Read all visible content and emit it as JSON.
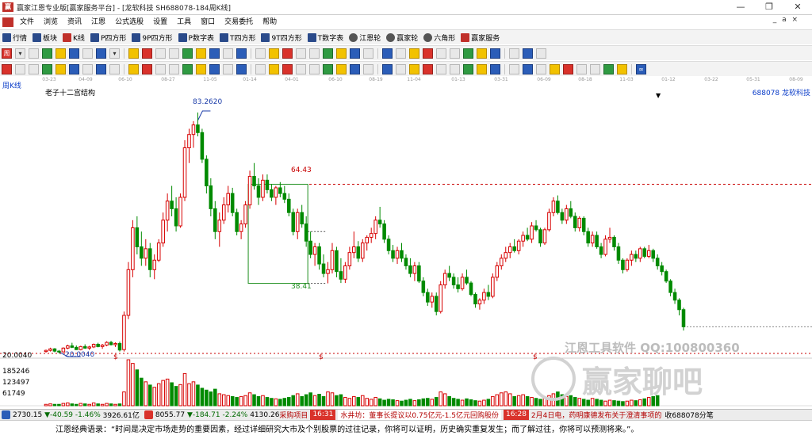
{
  "window": {
    "title": "赢家江恩专业版[赢家服务平台] - [龙软科技  SH688078-184周K线]",
    "controls": [
      "—",
      "❐",
      "✕"
    ]
  },
  "menu": {
    "items": [
      "文件",
      "浏览",
      "资讯",
      "江恩",
      "公式选股",
      "设置",
      "工具",
      "窗口",
      "交易委托",
      "帮助"
    ],
    "sub_controls": "_ a ×"
  },
  "toolbar1": {
    "items": [
      "行情",
      "板块",
      "K线",
      "P四方形",
      "9P四方形",
      "P数字表",
      "T四方形",
      "9T四方形",
      "T数字表",
      "江恩轮",
      "赢家轮",
      "六角形",
      "赢家服务"
    ]
  },
  "toolbar2": {
    "icons": [
      "周",
      "▾",
      "",
      "",
      "",
      "",
      "",
      "",
      "▾",
      "",
      "",
      "",
      "",
      "",
      "",
      "",
      "",
      "",
      "",
      "",
      "",
      "",
      "",
      "",
      "",
      "",
      "",
      "",
      "",
      "",
      "",
      "",
      "",
      "",
      "",
      "",
      "",
      "",
      ""
    ]
  },
  "toolbar3": {
    "icons": [
      "",
      "",
      "",
      "",
      "",
      "",
      "",
      "",
      "",
      "",
      "",
      "",
      "",
      "",
      "",
      "",
      "",
      "",
      "",
      "",
      "",
      "",
      "",
      "",
      "",
      "",
      "",
      "",
      "",
      "",
      "",
      "",
      "",
      "",
      "",
      "",
      "",
      "",
      "",
      "",
      "",
      "",
      "",
      "",
      "",
      "∞"
    ]
  },
  "chart": {
    "period_label": "周K线",
    "title": "老子十二宫结构",
    "stock": "688078  龙软科技",
    "date_ticks": [
      "03-23",
      "04-09",
      "06-10",
      "08-27",
      "11-05",
      "01-14",
      "04-01",
      "06-10",
      "08-19",
      "11-04",
      "01-13",
      "03-31",
      "06-09",
      "08-18",
      "11-03",
      "01-12",
      "03-22",
      "05-31",
      "08-09"
    ],
    "annotations": {
      "high": "83.2620",
      "box_top": "64.43",
      "box_bottom": "38.41",
      "low": "20.0040",
      "axis_low": "20.0040"
    },
    "volume_ticks": [
      "185246",
      "123497",
      "61749"
    ],
    "dollar_marks": [
      "$",
      "$",
      "$"
    ],
    "watermark_text": "江恩工具软件  QQ:100800360",
    "watermark_brand": "赢家聊吧",
    "colors": {
      "up": "#d70000",
      "down": "#008a00",
      "annot": "#1a3ba8",
      "box": "#1f8f1f",
      "dashed": "#c80000"
    },
    "candles": [
      [
        20.5,
        21.0,
        20.2,
        20.8
      ],
      [
        20.8,
        21.5,
        20.5,
        21.2
      ],
      [
        21.2,
        21.4,
        20.3,
        20.6
      ],
      [
        20.6,
        20.9,
        20.0,
        20.4
      ],
      [
        20.4,
        21.6,
        20.3,
        21.4
      ],
      [
        21.4,
        22.3,
        21.1,
        22.0
      ],
      [
        22.0,
        22.8,
        21.4,
        21.6
      ],
      [
        21.6,
        22.1,
        20.9,
        21.0
      ],
      [
        21.0,
        22.0,
        20.8,
        21.8
      ],
      [
        21.8,
        22.4,
        21.2,
        21.4
      ],
      [
        21.4,
        22.0,
        20.9,
        21.7
      ],
      [
        21.7,
        22.6,
        21.4,
        22.4
      ],
      [
        22.4,
        22.8,
        21.6,
        21.8
      ],
      [
        21.8,
        22.5,
        21.2,
        22.2
      ],
      [
        22.2,
        23.2,
        21.9,
        22.9
      ],
      [
        22.9,
        23.3,
        22.1,
        22.3
      ],
      [
        22.3,
        22.9,
        21.7,
        22.6
      ],
      [
        22.6,
        23.1,
        20.5,
        20.9
      ],
      [
        21.0,
        31.0,
        20.5,
        30.0
      ],
      [
        30.0,
        44.0,
        29.0,
        42.0
      ],
      [
        42.0,
        55.0,
        40.0,
        53.0
      ],
      [
        53.0,
        56.0,
        46.0,
        48.0
      ],
      [
        48.0,
        52.0,
        43.0,
        45.0
      ],
      [
        45.0,
        50.0,
        43.0,
        47.5
      ],
      [
        47.5,
        49.0,
        40.0,
        42.0
      ],
      [
        42.0,
        46.0,
        39.5,
        44.5
      ],
      [
        44.5,
        50.0,
        44.0,
        49.0
      ],
      [
        49.0,
        57.0,
        48.0,
        55.0
      ],
      [
        55.0,
        62.0,
        52.0,
        60.0
      ],
      [
        60.0,
        64.0,
        56.0,
        58.0
      ],
      [
        58.0,
        61.0,
        52.0,
        53.5
      ],
      [
        53.5,
        62.0,
        53.0,
        61.0
      ],
      [
        61.0,
        76.0,
        60.0,
        74.0
      ],
      [
        74.0,
        79.0,
        70.0,
        77.5
      ],
      [
        77.5,
        81.0,
        74.0,
        80.0
      ],
      [
        80.0,
        83.26,
        77.0,
        78.0
      ],
      [
        78.0,
        79.0,
        70.0,
        71.0
      ],
      [
        71.0,
        72.0,
        62.0,
        64.0
      ],
      [
        64.0,
        66.0,
        56.0,
        58.0
      ],
      [
        58.0,
        60.0,
        50.0,
        52.0
      ],
      [
        52.0,
        57.0,
        48.0,
        55.0
      ],
      [
        55.0,
        61.0,
        54.0,
        59.0
      ],
      [
        59.0,
        64.0,
        57.0,
        62.0
      ],
      [
        62.0,
        63.5,
        56.0,
        57.0
      ],
      [
        57.0,
        58.0,
        51.0,
        52.0
      ],
      [
        52.0,
        55.0,
        50.0,
        54.0
      ],
      [
        54.0,
        60.0,
        53.0,
        59.0
      ],
      [
        59.0,
        68.0,
        58.0,
        66.5
      ],
      [
        66.5,
        70.0,
        63.0,
        64.0
      ],
      [
        64.0,
        66.0,
        59.0,
        61.0
      ],
      [
        61.0,
        67.0,
        60.0,
        65.5
      ],
      [
        65.5,
        67.0,
        62.0,
        63.0
      ],
      [
        63.0,
        64.5,
        60.0,
        61.0
      ],
      [
        61.0,
        64.0,
        59.0,
        63.5
      ],
      [
        63.5,
        65.0,
        61.0,
        62.0
      ],
      [
        62.0,
        64.0,
        59.5,
        60.5
      ],
      [
        60.5,
        62.0,
        56.0,
        57.0
      ],
      [
        57.0,
        58.0,
        51.0,
        52.0
      ],
      [
        52.0,
        58.0,
        50.0,
        57.0
      ],
      [
        57.0,
        59.0,
        53.0,
        54.0
      ],
      [
        54.0,
        56.0,
        48.0,
        49.5
      ],
      [
        49.5,
        52.0,
        45.0,
        46.0
      ],
      [
        46.0,
        49.0,
        43.0,
        48.0
      ],
      [
        48.0,
        49.0,
        42.0,
        43.5
      ],
      [
        43.5,
        46.0,
        40.0,
        41.0
      ],
      [
        41.0,
        44.0,
        38.41,
        42.0
      ],
      [
        42.0,
        49.0,
        41.0,
        47.0
      ],
      [
        47.0,
        48.0,
        40.0,
        41.5
      ],
      [
        41.5,
        45.0,
        38.5,
        39.5
      ],
      [
        39.5,
        44.0,
        38.5,
        43.0
      ],
      [
        43.0,
        48.0,
        42.0,
        46.5
      ],
      [
        46.5,
        52.0,
        45.0,
        48.0
      ],
      [
        48.0,
        49.5,
        44.0,
        45.0
      ],
      [
        45.0,
        50.0,
        44.0,
        49.0
      ],
      [
        49.0,
        51.0,
        47.0,
        50.5
      ],
      [
        50.5,
        53.0,
        49.0,
        51.5
      ],
      [
        51.5,
        56.0,
        50.0,
        55.0
      ],
      [
        55.0,
        58.5,
        53.0,
        54.0
      ],
      [
        54.0,
        55.0,
        49.0,
        50.0
      ],
      [
        50.0,
        51.0,
        46.0,
        47.0
      ],
      [
        47.0,
        48.5,
        44.0,
        45.0
      ],
      [
        45.0,
        48.0,
        43.5,
        47.0
      ],
      [
        47.0,
        49.0,
        44.0,
        45.0
      ],
      [
        45.0,
        46.0,
        42.0,
        43.0
      ],
      [
        43.0,
        45.0,
        40.0,
        41.0
      ],
      [
        41.0,
        44.0,
        39.0,
        43.0
      ],
      [
        43.0,
        44.0,
        38.5,
        39.0
      ],
      [
        39.0,
        40.0,
        35.0,
        36.0
      ],
      [
        36.0,
        37.0,
        32.5,
        33.5
      ],
      [
        33.5,
        36.0,
        32.0,
        35.0
      ],
      [
        35.0,
        36.0,
        30.0,
        31.0
      ],
      [
        31.0,
        39.0,
        30.5,
        38.0
      ],
      [
        38.0,
        42.0,
        37.0,
        41.0
      ],
      [
        41.0,
        43.0,
        39.0,
        40.0
      ],
      [
        40.0,
        41.0,
        37.0,
        38.0
      ],
      [
        38.0,
        40.0,
        36.0,
        37.0
      ],
      [
        37.0,
        41.0,
        36.5,
        40.0
      ],
      [
        40.0,
        42.0,
        38.0,
        38.5
      ],
      [
        38.5,
        39.0,
        35.0,
        35.5
      ],
      [
        35.5,
        36.0,
        32.0,
        33.0
      ],
      [
        33.0,
        34.5,
        31.5,
        34.0
      ],
      [
        34.0,
        37.0,
        33.0,
        36.0
      ],
      [
        36.0,
        38.0,
        34.0,
        35.0
      ],
      [
        35.0,
        41.0,
        34.5,
        40.0
      ],
      [
        40.0,
        44.0,
        39.0,
        43.0
      ],
      [
        43.0,
        46.0,
        42.0,
        45.0
      ],
      [
        45.0,
        48.0,
        44.0,
        46.5
      ],
      [
        46.5,
        49.0,
        45.0,
        48.0
      ],
      [
        48.0,
        50.0,
        46.5,
        47.0
      ],
      [
        47.0,
        50.0,
        46.0,
        49.5
      ],
      [
        49.5,
        52.0,
        48.0,
        51.0
      ],
      [
        51.0,
        53.0,
        49.5,
        50.0
      ],
      [
        50.0,
        54.5,
        49.0,
        53.5
      ],
      [
        53.5,
        55.0,
        52.0,
        52.5
      ],
      [
        52.5,
        53.0,
        48.0,
        49.0
      ],
      [
        49.0,
        53.0,
        48.5,
        52.5
      ],
      [
        52.5,
        58.0,
        52.0,
        57.0
      ],
      [
        57.0,
        61.0,
        56.0,
        60.0
      ],
      [
        60.0,
        61.5,
        56.5,
        57.0
      ],
      [
        57.0,
        58.0,
        54.0,
        55.0
      ],
      [
        55.0,
        59.0,
        54.0,
        58.0
      ],
      [
        58.0,
        60.0,
        55.5,
        56.0
      ],
      [
        56.0,
        57.0,
        52.0,
        53.0
      ],
      [
        53.0,
        56.0,
        52.0,
        55.5
      ],
      [
        55.5,
        56.0,
        51.0,
        52.0
      ],
      [
        52.0,
        53.0,
        48.0,
        49.0
      ],
      [
        49.0,
        52.0,
        48.0,
        51.0
      ],
      [
        51.0,
        52.0,
        47.5,
        48.0
      ],
      [
        48.0,
        49.0,
        45.0,
        46.0
      ],
      [
        46.0,
        51.0,
        45.5,
        50.0
      ],
      [
        50.0,
        53.0,
        49.0,
        50.5
      ],
      [
        50.5,
        51.0,
        47.0,
        48.0
      ],
      [
        48.0,
        49.0,
        43.5,
        44.5
      ],
      [
        44.5,
        45.0,
        41.0,
        42.0
      ],
      [
        42.0,
        45.0,
        41.5,
        44.5
      ],
      [
        44.5,
        47.0,
        43.0,
        46.0
      ],
      [
        46.0,
        47.0,
        44.0,
        45.0
      ],
      [
        45.0,
        48.0,
        44.0,
        47.5
      ],
      [
        47.5,
        48.0,
        45.0,
        45.5
      ],
      [
        45.5,
        48.5,
        45.0,
        47.0
      ],
      [
        47.0,
        47.5,
        44.0,
        45.0
      ],
      [
        45.0,
        46.0,
        42.0,
        43.0
      ],
      [
        43.0,
        44.0,
        40.5,
        41.5
      ],
      [
        41.5,
        42.0,
        38.5,
        39.0
      ],
      [
        39.0,
        39.5,
        35.0,
        36.0
      ],
      [
        36.0,
        37.0,
        33.0,
        34.0
      ],
      [
        34.0,
        34.5,
        30.0,
        31.5
      ],
      [
        31.5,
        32.0,
        26.0,
        27.0
      ]
    ],
    "volumes": [
      3,
      4,
      3,
      3,
      5,
      6,
      4,
      3,
      5,
      4,
      3,
      6,
      4,
      3,
      5,
      4,
      3,
      4,
      30,
      100,
      92,
      78,
      60,
      52,
      45,
      40,
      48,
      55,
      58,
      50,
      42,
      46,
      70,
      48,
      52,
      45,
      38,
      34,
      30,
      36,
      26,
      24,
      22,
      20,
      18,
      20,
      22,
      28,
      24,
      20,
      22,
      18,
      16,
      15,
      14,
      16,
      18,
      22,
      26,
      20,
      24,
      28,
      22,
      25,
      20,
      30,
      28,
      22,
      24,
      18,
      16,
      20,
      18,
      22,
      16,
      14,
      18,
      15,
      12,
      14,
      13,
      11,
      10,
      12,
      14,
      11,
      13,
      15,
      16,
      14,
      18,
      30,
      26,
      20,
      16,
      14,
      12,
      15,
      13,
      11,
      10,
      12,
      14,
      20,
      24,
      28,
      30,
      26,
      20,
      22,
      24,
      20,
      18,
      16,
      14,
      18,
      22,
      26,
      30,
      24,
      20,
      22,
      18,
      16,
      14,
      12,
      16,
      14,
      12,
      10,
      12,
      11,
      10,
      9,
      10,
      12,
      11,
      13,
      15,
      18,
      20,
      22
    ]
  },
  "status": {
    "idx1_value": "2730.15",
    "idx1_change": "▼-40.59",
    "idx1_pct": "-1.46%",
    "idx1_amount": "3926.61亿",
    "idx2_value": "8055.77",
    "idx2_change": "▼-184.71",
    "idx2_pct": "-2.24%",
    "idx2_amount": "4130.26",
    "tag1": "采购项目",
    "badge": "16:31",
    "news1": "水井坊：董事长提议以0.75亿元-1.5亿元回购股份",
    "badge2": "16:28",
    "news2": "2月4日电，药明康德发布关于澄清事项的",
    "code": "收688078分笔"
  },
  "quote": {
    "text": "江恩经典语录：“时间是决定市场走势的重要因素，经过详细研究大市及个别股票的过往记录，你将可以证明，历史确实重复发生；而了解过往，你将可以预测将来。”。"
  }
}
